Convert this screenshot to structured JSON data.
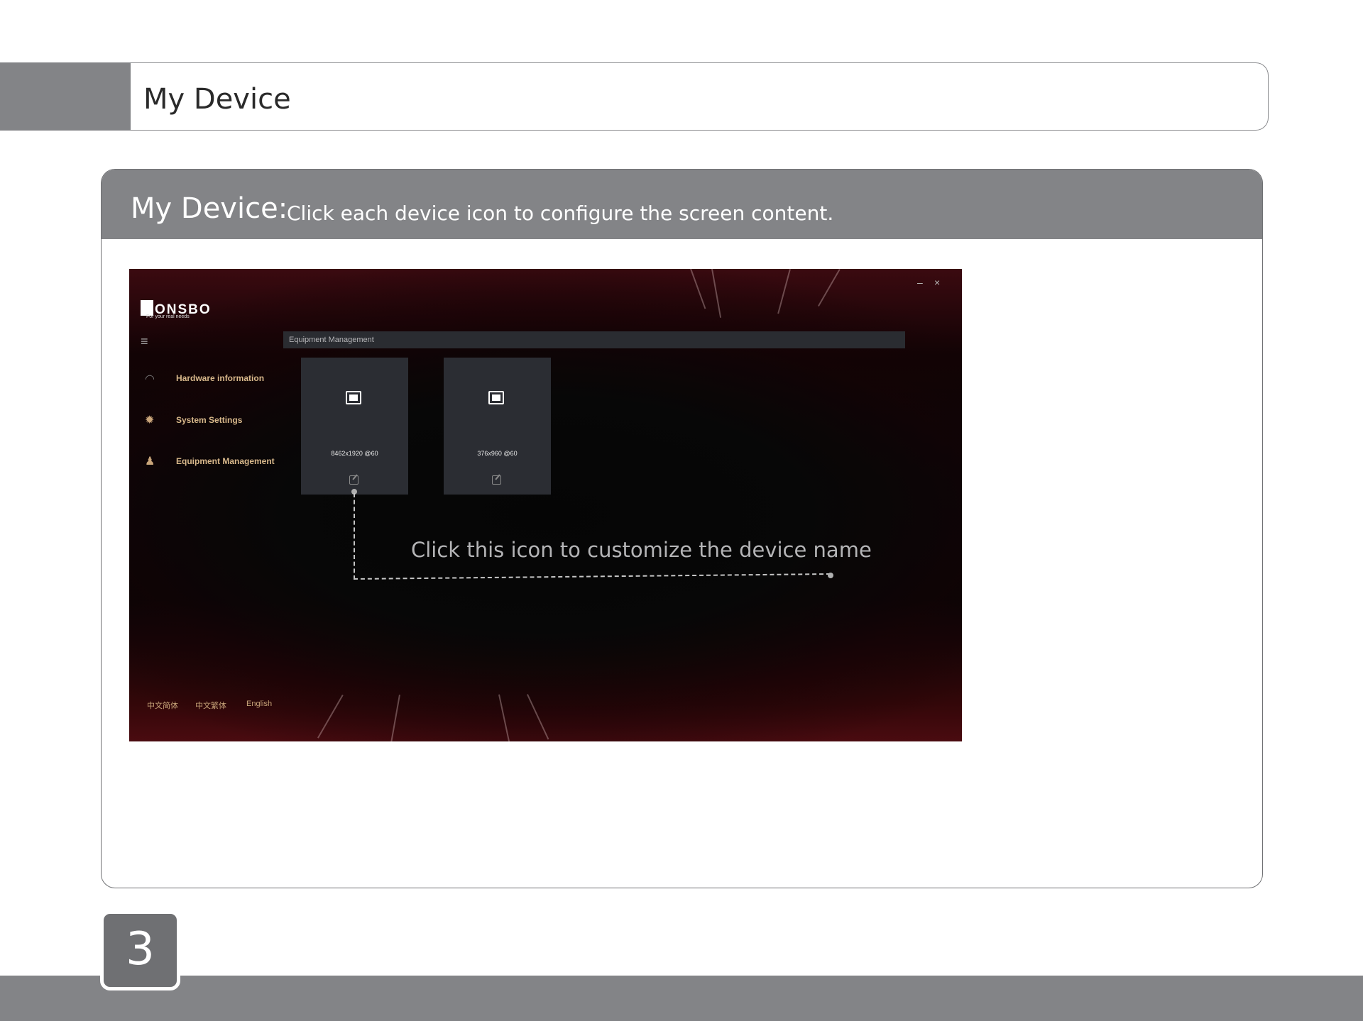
{
  "header": {
    "title": "My Device"
  },
  "panel": {
    "heading": "My Device:",
    "subheading": "Click each device icon to configure the screen content."
  },
  "app": {
    "brand": "ONSBO",
    "tagline": "For your real needs",
    "window_controls": {
      "minimize": "–",
      "close": "×"
    },
    "breadcrumb": "Equipment Management",
    "nav": [
      {
        "label": "Hardware information",
        "icon": "gauge-icon"
      },
      {
        "label": "System Settings",
        "icon": "gear-icon"
      },
      {
        "label": "Equipment Management",
        "icon": "user-icon"
      }
    ],
    "devices": [
      {
        "resolution": "8462x1920 @60"
      },
      {
        "resolution": "376x960 @60"
      }
    ],
    "callout": "Click this icon to customize the device name",
    "languages": [
      "中文简体",
      "中文繁体",
      "English"
    ]
  },
  "footer": {
    "page_number": "3"
  },
  "colors": {
    "band_gray": "#838487",
    "page_badge": "#6f7073",
    "nav_gold": "#d8b88b"
  }
}
